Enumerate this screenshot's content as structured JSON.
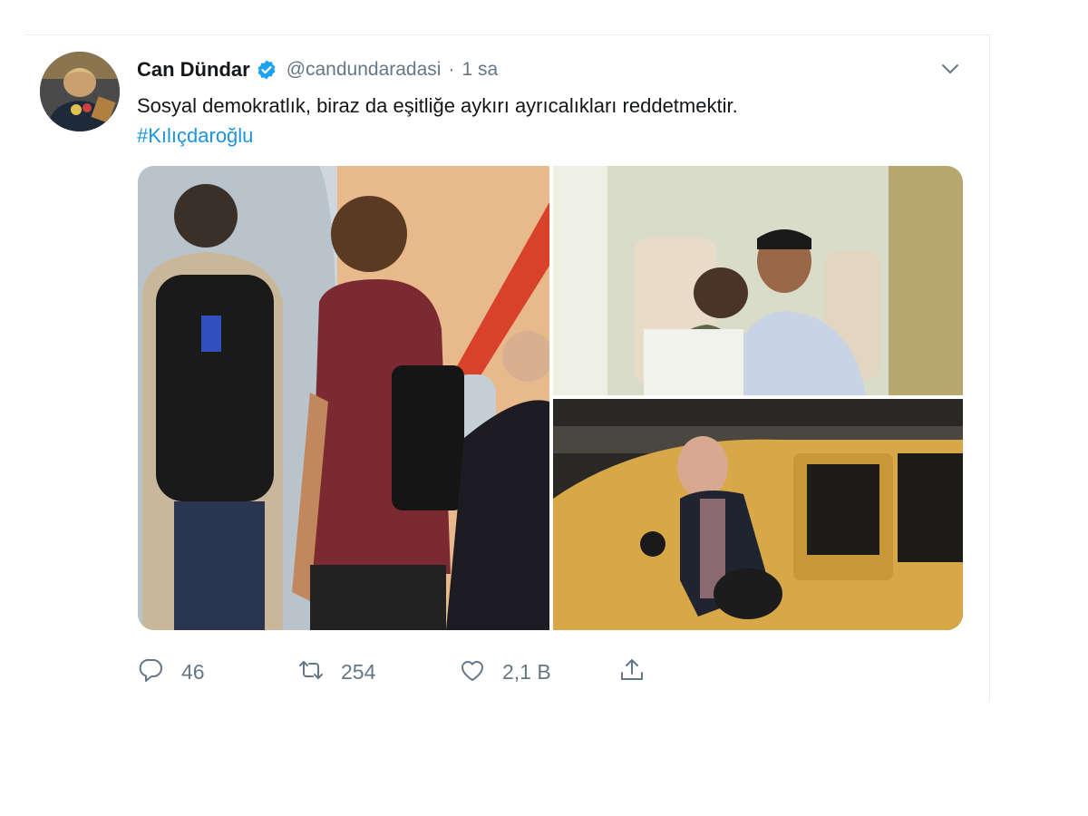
{
  "tweet": {
    "display_name": "Can Dündar",
    "handle": "@candundaradasi",
    "separator": "·",
    "time": "1 sa",
    "text": "Sosyal demokratlık, biraz da eşitliğe aykırı ayrıcalıkları reddetmektir.",
    "hashtag": "#Kılıçdaroğlu"
  },
  "icons": {
    "verified": "verified-badge-icon",
    "menu": "chevron-down-icon",
    "reply": "reply-icon",
    "retweet": "retweet-icon",
    "like": "heart-icon",
    "share": "share-icon"
  },
  "media": [
    {
      "description_id": "boarding-plane-photo"
    },
    {
      "description_id": "airplane-seat-couple-photo"
    },
    {
      "description_id": "taxi-exit-photo"
    }
  ],
  "actions": {
    "reply_count": "46",
    "retweet_count": "254",
    "like_count": "2,1 B"
  },
  "colors": {
    "verified": "#1da1f2",
    "link": "#1b95e0",
    "secondary_text": "#657786",
    "border": "#e6ecf0"
  }
}
